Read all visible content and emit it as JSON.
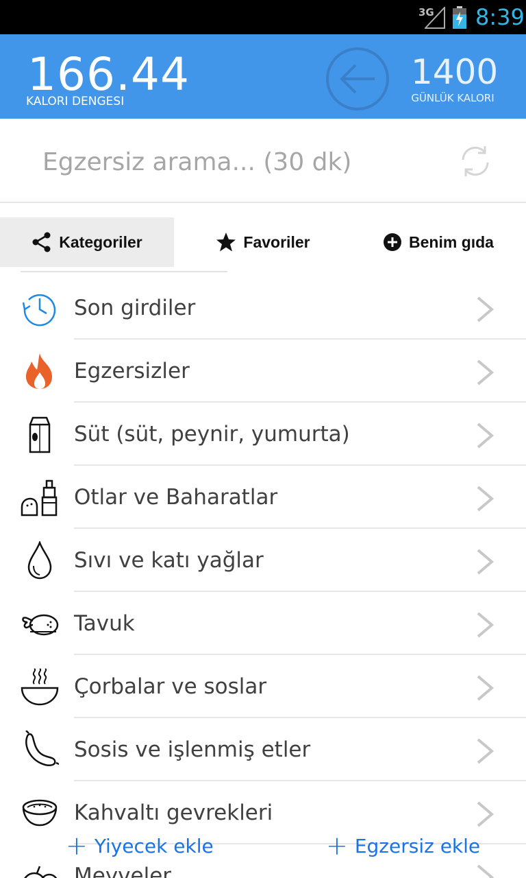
{
  "status_bar": {
    "network": "3G",
    "time": "8:39",
    "time_color": "#33b5e5"
  },
  "header": {
    "background": "#4196ea",
    "balance_value": "166.44",
    "balance_label": "KALORI DENGESI",
    "daily_value": "1400",
    "daily_label": "GÜNLÜK KALORI",
    "back_icon": "arrow-left-circle-icon"
  },
  "search": {
    "placeholder": "Egzersiz arama... (30 dk)",
    "refresh_icon": "refresh-icon"
  },
  "tabs": [
    {
      "label": "Kategoriler",
      "icon": "share-icon",
      "selected": true
    },
    {
      "label": "Favoriler",
      "icon": "star-icon",
      "selected": false
    },
    {
      "label": "Benim gıda",
      "icon": "plus-circle-icon",
      "selected": false
    }
  ],
  "categories": [
    {
      "label": "Son girdiler",
      "icon": "clock-history-icon"
    },
    {
      "label": "Egzersizler",
      "icon": "fire-icon"
    },
    {
      "label": "Süt (süt, peynir, yumurta)",
      "icon": "milk-carton-icon"
    },
    {
      "label": "Otlar ve Baharatlar",
      "icon": "spice-grinder-icon"
    },
    {
      "label": "Sıvı ve katı yağlar",
      "icon": "oil-drop-icon"
    },
    {
      "label": "Tavuk",
      "icon": "roast-chicken-icon"
    },
    {
      "label": "Çorbalar ve soslar",
      "icon": "soup-bowl-icon"
    },
    {
      "label": "Sosis ve işlenmiş etler",
      "icon": "sausage-icon"
    },
    {
      "label": "Kahvaltı gevrekleri",
      "icon": "cereal-bowl-icon"
    },
    {
      "label": "Meyveler",
      "icon": "fruit-icon"
    }
  ],
  "bottom_actions": {
    "add_food": "Yiyecek ekle",
    "add_exercise": "Egzersiz ekle",
    "color": "#1a73e8"
  }
}
